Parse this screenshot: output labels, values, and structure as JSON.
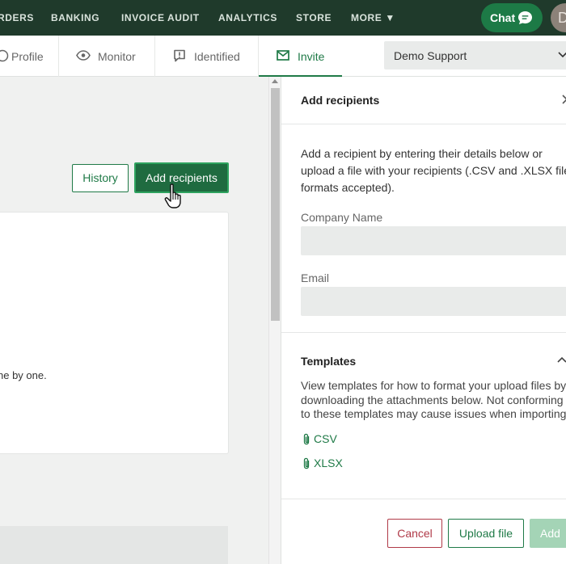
{
  "nav": {
    "items": [
      "RDERS",
      "BANKING",
      "INVOICE AUDIT",
      "ANALYTICS",
      "STORE",
      "MORE ▼"
    ],
    "chat_label": "Chat",
    "avatar_initial": "D"
  },
  "tabs": [
    {
      "label": "Profile",
      "icon": "eye-icon"
    },
    {
      "label": "Monitor",
      "icon": "eye-icon"
    },
    {
      "label": "Identified",
      "icon": "flag-icon"
    },
    {
      "label": "Invite",
      "icon": "mail-icon",
      "active": true
    }
  ],
  "org_select": {
    "value": "Demo Support"
  },
  "main": {
    "history_label": "History",
    "add_recipients_label": "Add recipients",
    "card_text": "ne by one."
  },
  "panel": {
    "title": "Add recipients",
    "description": "Add a recipient by entering their details below or upload a file with your recipients (.CSV and .XLSX file formats accepted).",
    "company_label": "Company Name",
    "email_label": "Email",
    "templates_title": "Templates",
    "templates_description": "View templates for how to format your upload files by downloading the attachments below. Not conforming to these templates may cause issues when importing.",
    "attachments": [
      "CSV",
      "XLSX"
    ],
    "cancel_label": "Cancel",
    "upload_label": "Upload file",
    "add_label": "Add"
  },
  "colors": {
    "nav_bg": "#1f3a2b",
    "accent": "#1f7a47",
    "danger": "#b03a48"
  }
}
